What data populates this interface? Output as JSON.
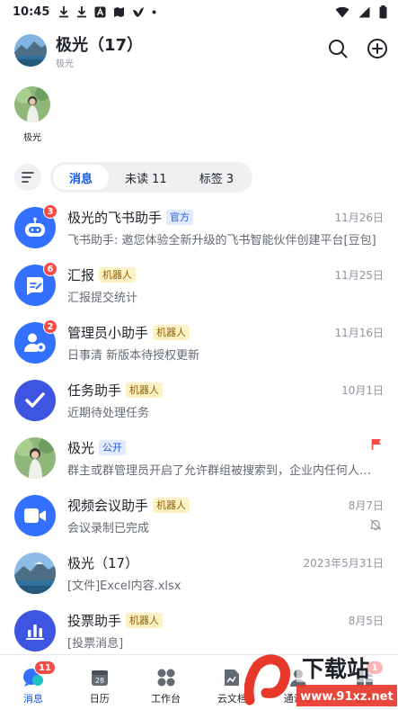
{
  "status_bar": {
    "time": "10:45"
  },
  "header": {
    "title": "极光（17）",
    "subtitle": "极光"
  },
  "story": {
    "label": "极光"
  },
  "tabs": [
    {
      "label": "消息"
    },
    {
      "label": "未读 11"
    },
    {
      "label": "标签 3"
    }
  ],
  "chats": [
    {
      "name": "极光的飞书助手",
      "tag": "官方",
      "date": "11月26日",
      "preview": "飞书助手: 邀您体验全新升级的飞书智能伙伴创建平台[豆包]",
      "badge": "3"
    },
    {
      "name": "汇报",
      "tag": "机器人",
      "date": "11月25日",
      "preview": "汇报提交统计",
      "badge": "6"
    },
    {
      "name": "管理员小助手",
      "tag": "机器人",
      "date": "11月16日",
      "preview": "日事清 新版本待授权更新",
      "badge": "2"
    },
    {
      "name": "任务助手",
      "tag": "机器人",
      "date": "10月1日",
      "preview": "近期待处理任务"
    },
    {
      "name": "极光",
      "tag": "公开",
      "date": "",
      "preview": "群主或群管理员开启了允许群组被搜索到，企业内任何人都可以搜索到该群"
    },
    {
      "name": "视频会议助手",
      "tag": "机器人",
      "date": "8月7日",
      "preview": "会议录制已完成"
    },
    {
      "name": "极光（17）",
      "tag": "",
      "date": "2023年5月31日",
      "preview": "[文件]Excel内容.xlsx"
    },
    {
      "name": "投票助手",
      "tag": "机器人",
      "date": "8月5日",
      "preview": "[投票消息]"
    }
  ],
  "bottom_nav": [
    {
      "label": "消息",
      "badge": "11"
    },
    {
      "label": "日历",
      "cal_day": "28"
    },
    {
      "label": "工作台"
    },
    {
      "label": "云文档"
    },
    {
      "label": "通讯录"
    },
    {
      "label": "更多",
      "badge": "1"
    }
  ],
  "watermark": {
    "text": "下载站",
    "url": "www.91xz.net"
  },
  "colors": {
    "accent": "#1456f0",
    "badge": "#f54a45",
    "official_tag": "#e1eaff",
    "bot_tag": "#fdf1c6"
  },
  "icons": [
    "download-icon",
    "translate-icon",
    "map-icon",
    "bird-icon",
    "wifi-icon",
    "battery-icon",
    "search-icon",
    "add-circle-icon",
    "filter-icon",
    "robot-icon",
    "report-icon",
    "admin-icon",
    "task-icon",
    "video-icon",
    "poll-icon",
    "flag-icon",
    "mute-icon",
    "chat-icon",
    "calendar-icon",
    "workbench-icon",
    "cloud-doc-icon",
    "contacts-icon",
    "more-icon"
  ]
}
